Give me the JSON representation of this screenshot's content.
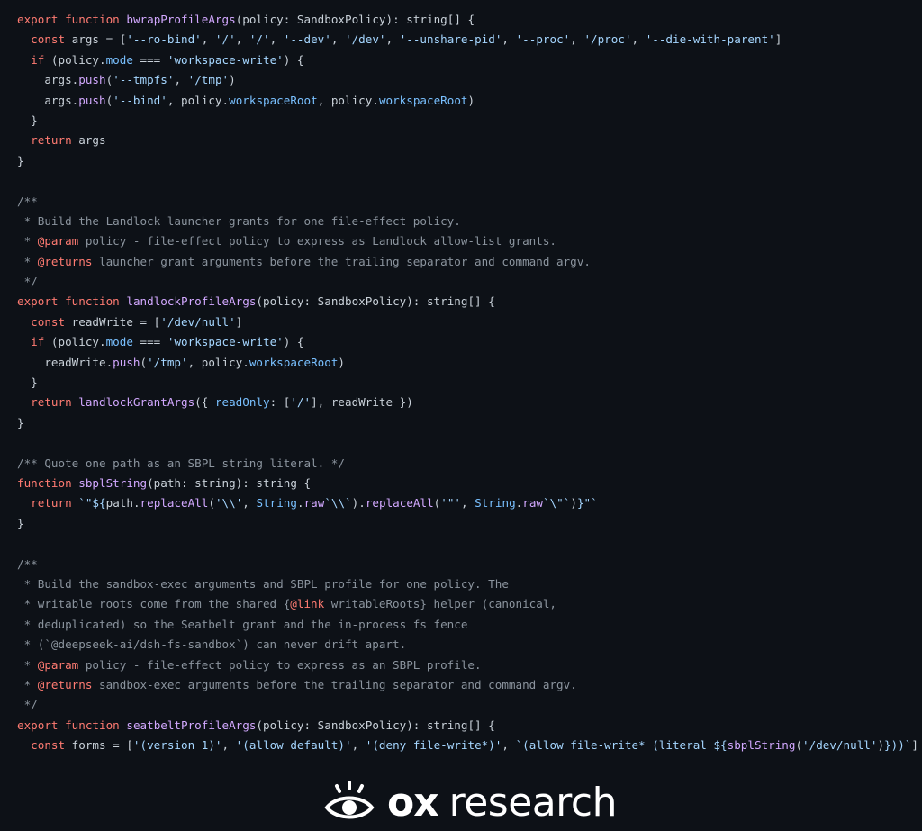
{
  "code": {
    "lines": [
      [
        {
          "t": "export",
          "c": "kw"
        },
        {
          "t": " "
        },
        {
          "t": "function",
          "c": "kw"
        },
        {
          "t": " "
        },
        {
          "t": "bwrapProfileArgs",
          "c": "fn"
        },
        {
          "t": "(policy: SandboxPolicy): string[] {"
        }
      ],
      [
        {
          "t": "  "
        },
        {
          "t": "const",
          "c": "kw"
        },
        {
          "t": " args = ["
        },
        {
          "t": "'--ro-bind'",
          "c": "str"
        },
        {
          "t": ", "
        },
        {
          "t": "'/'",
          "c": "str"
        },
        {
          "t": ", "
        },
        {
          "t": "'/'",
          "c": "str"
        },
        {
          "t": ", "
        },
        {
          "t": "'--dev'",
          "c": "str"
        },
        {
          "t": ", "
        },
        {
          "t": "'/dev'",
          "c": "str"
        },
        {
          "t": ", "
        },
        {
          "t": "'--unshare-pid'",
          "c": "str"
        },
        {
          "t": ", "
        },
        {
          "t": "'--proc'",
          "c": "str"
        },
        {
          "t": ", "
        },
        {
          "t": "'/proc'",
          "c": "str"
        },
        {
          "t": ", "
        },
        {
          "t": "'--die-with-parent'",
          "c": "str"
        },
        {
          "t": "]"
        }
      ],
      [
        {
          "t": "  "
        },
        {
          "t": "if",
          "c": "kw"
        },
        {
          "t": " (policy."
        },
        {
          "t": "mode",
          "c": "prop"
        },
        {
          "t": " === "
        },
        {
          "t": "'workspace-write'",
          "c": "str"
        },
        {
          "t": ") {"
        }
      ],
      [
        {
          "t": "    args."
        },
        {
          "t": "push",
          "c": "fn"
        },
        {
          "t": "("
        },
        {
          "t": "'--tmpfs'",
          "c": "str"
        },
        {
          "t": ", "
        },
        {
          "t": "'/tmp'",
          "c": "str"
        },
        {
          "t": ")"
        }
      ],
      [
        {
          "t": "    args."
        },
        {
          "t": "push",
          "c": "fn"
        },
        {
          "t": "("
        },
        {
          "t": "'--bind'",
          "c": "str"
        },
        {
          "t": ", policy."
        },
        {
          "t": "workspaceRoot",
          "c": "prop"
        },
        {
          "t": ", policy."
        },
        {
          "t": "workspaceRoot",
          "c": "prop"
        },
        {
          "t": ")"
        }
      ],
      [
        {
          "t": "  }"
        }
      ],
      [
        {
          "t": "  "
        },
        {
          "t": "return",
          "c": "kw"
        },
        {
          "t": " args"
        }
      ],
      [
        {
          "t": "}"
        }
      ],
      [
        {
          "t": ""
        }
      ],
      [
        {
          "t": "/**",
          "c": "cm"
        }
      ],
      [
        {
          "t": " * Build the Landlock launcher grants for one file-effect policy.",
          "c": "cm"
        }
      ],
      [
        {
          "t": " * ",
          "c": "cm"
        },
        {
          "t": "@param",
          "c": "tag"
        },
        {
          "t": " policy - file-effect policy to express as Landlock allow-list grants.",
          "c": "cm"
        }
      ],
      [
        {
          "t": " * ",
          "c": "cm"
        },
        {
          "t": "@returns",
          "c": "tag"
        },
        {
          "t": " launcher grant arguments before the trailing separator and command argv.",
          "c": "cm"
        }
      ],
      [
        {
          "t": " */",
          "c": "cm"
        }
      ],
      [
        {
          "t": "export",
          "c": "kw"
        },
        {
          "t": " "
        },
        {
          "t": "function",
          "c": "kw"
        },
        {
          "t": " "
        },
        {
          "t": "landlockProfileArgs",
          "c": "fn"
        },
        {
          "t": "(policy: SandboxPolicy): string[] {"
        }
      ],
      [
        {
          "t": "  "
        },
        {
          "t": "const",
          "c": "kw"
        },
        {
          "t": " readWrite = ["
        },
        {
          "t": "'/dev/null'",
          "c": "str"
        },
        {
          "t": "]"
        }
      ],
      [
        {
          "t": "  "
        },
        {
          "t": "if",
          "c": "kw"
        },
        {
          "t": " (policy."
        },
        {
          "t": "mode",
          "c": "prop"
        },
        {
          "t": " === "
        },
        {
          "t": "'workspace-write'",
          "c": "str"
        },
        {
          "t": ") {"
        }
      ],
      [
        {
          "t": "    readWrite."
        },
        {
          "t": "push",
          "c": "fn"
        },
        {
          "t": "("
        },
        {
          "t": "'/tmp'",
          "c": "str"
        },
        {
          "t": ", policy."
        },
        {
          "t": "workspaceRoot",
          "c": "prop"
        },
        {
          "t": ")"
        }
      ],
      [
        {
          "t": "  }"
        }
      ],
      [
        {
          "t": "  "
        },
        {
          "t": "return",
          "c": "kw"
        },
        {
          "t": " "
        },
        {
          "t": "landlockGrantArgs",
          "c": "fn"
        },
        {
          "t": "({ "
        },
        {
          "t": "readOnly",
          "c": "prop"
        },
        {
          "t": ": ["
        },
        {
          "t": "'/'",
          "c": "str"
        },
        {
          "t": "], readWrite })"
        }
      ],
      [
        {
          "t": "}"
        }
      ],
      [
        {
          "t": ""
        }
      ],
      [
        {
          "t": "/** Quote one path as an SBPL string literal. */",
          "c": "cm"
        }
      ],
      [
        {
          "t": "function",
          "c": "kw"
        },
        {
          "t": " "
        },
        {
          "t": "sbplString",
          "c": "fn"
        },
        {
          "t": "(path: string): string {"
        }
      ],
      [
        {
          "t": "  "
        },
        {
          "t": "return",
          "c": "kw"
        },
        {
          "t": " "
        },
        {
          "t": "`\"${",
          "c": "str"
        },
        {
          "t": "path."
        },
        {
          "t": "replaceAll",
          "c": "fn"
        },
        {
          "t": "("
        },
        {
          "t": "'\\\\'",
          "c": "str"
        },
        {
          "t": ", "
        },
        {
          "t": "String",
          "c": "prop"
        },
        {
          "t": "."
        },
        {
          "t": "raw",
          "c": "fn"
        },
        {
          "t": "`\\\\`",
          "c": "str"
        },
        {
          "t": ")."
        },
        {
          "t": "replaceAll",
          "c": "fn"
        },
        {
          "t": "("
        },
        {
          "t": "'\"'",
          "c": "str"
        },
        {
          "t": ", "
        },
        {
          "t": "String",
          "c": "prop"
        },
        {
          "t": "."
        },
        {
          "t": "raw",
          "c": "fn"
        },
        {
          "t": "`\\\"`",
          "c": "str"
        },
        {
          "t": ")"
        },
        {
          "t": "}\"`",
          "c": "str"
        }
      ],
      [
        {
          "t": "}"
        }
      ],
      [
        {
          "t": ""
        }
      ],
      [
        {
          "t": "/**",
          "c": "cm"
        }
      ],
      [
        {
          "t": " * Build the sandbox-exec arguments and SBPL profile for one policy. The",
          "c": "cm"
        }
      ],
      [
        {
          "t": " * writable roots come from the shared {",
          "c": "cm"
        },
        {
          "t": "@link",
          "c": "tag"
        },
        {
          "t": " writableRoots} helper (canonical,",
          "c": "cm"
        }
      ],
      [
        {
          "t": " * deduplicated) so the Seatbelt grant and the in-process fs fence",
          "c": "cm"
        }
      ],
      [
        {
          "t": " * (`@deepseek-ai/dsh-fs-sandbox`) can never drift apart.",
          "c": "cm"
        }
      ],
      [
        {
          "t": " * ",
          "c": "cm"
        },
        {
          "t": "@param",
          "c": "tag"
        },
        {
          "t": " policy - file-effect policy to express as an SBPL profile.",
          "c": "cm"
        }
      ],
      [
        {
          "t": " * ",
          "c": "cm"
        },
        {
          "t": "@returns",
          "c": "tag"
        },
        {
          "t": " sandbox-exec arguments before the trailing separator and command argv.",
          "c": "cm"
        }
      ],
      [
        {
          "t": " */",
          "c": "cm"
        }
      ],
      [
        {
          "t": "export",
          "c": "kw"
        },
        {
          "t": " "
        },
        {
          "t": "function",
          "c": "kw"
        },
        {
          "t": " "
        },
        {
          "t": "seatbeltProfileArgs",
          "c": "fn"
        },
        {
          "t": "(policy: SandboxPolicy): string[] {"
        }
      ],
      [
        {
          "t": "  "
        },
        {
          "t": "const",
          "c": "kw"
        },
        {
          "t": " forms = ["
        },
        {
          "t": "'(version 1)'",
          "c": "str"
        },
        {
          "t": ", "
        },
        {
          "t": "'(allow default)'",
          "c": "str"
        },
        {
          "t": ", "
        },
        {
          "t": "'(deny file-write*)'",
          "c": "str"
        },
        {
          "t": ", "
        },
        {
          "t": "`(allow file-write* (literal ${",
          "c": "str"
        },
        {
          "t": "sbplString",
          "c": "fn"
        },
        {
          "t": "("
        },
        {
          "t": "'/dev/null'",
          "c": "str"
        },
        {
          "t": ")"
        },
        {
          "t": "}))`",
          "c": "str"
        },
        {
          "t": "]"
        }
      ]
    ]
  },
  "brand": {
    "name_bold": "ox",
    "name_light": "research",
    "icon": "eye-icon",
    "color": "#ffffff"
  },
  "colors": {
    "background": "#0d1117",
    "keyword": "#ff7b72",
    "function": "#d2a8ff",
    "string": "#a5d6ff",
    "property": "#79c0ff",
    "comment": "#8b949e",
    "text": "#c9d1d9"
  }
}
